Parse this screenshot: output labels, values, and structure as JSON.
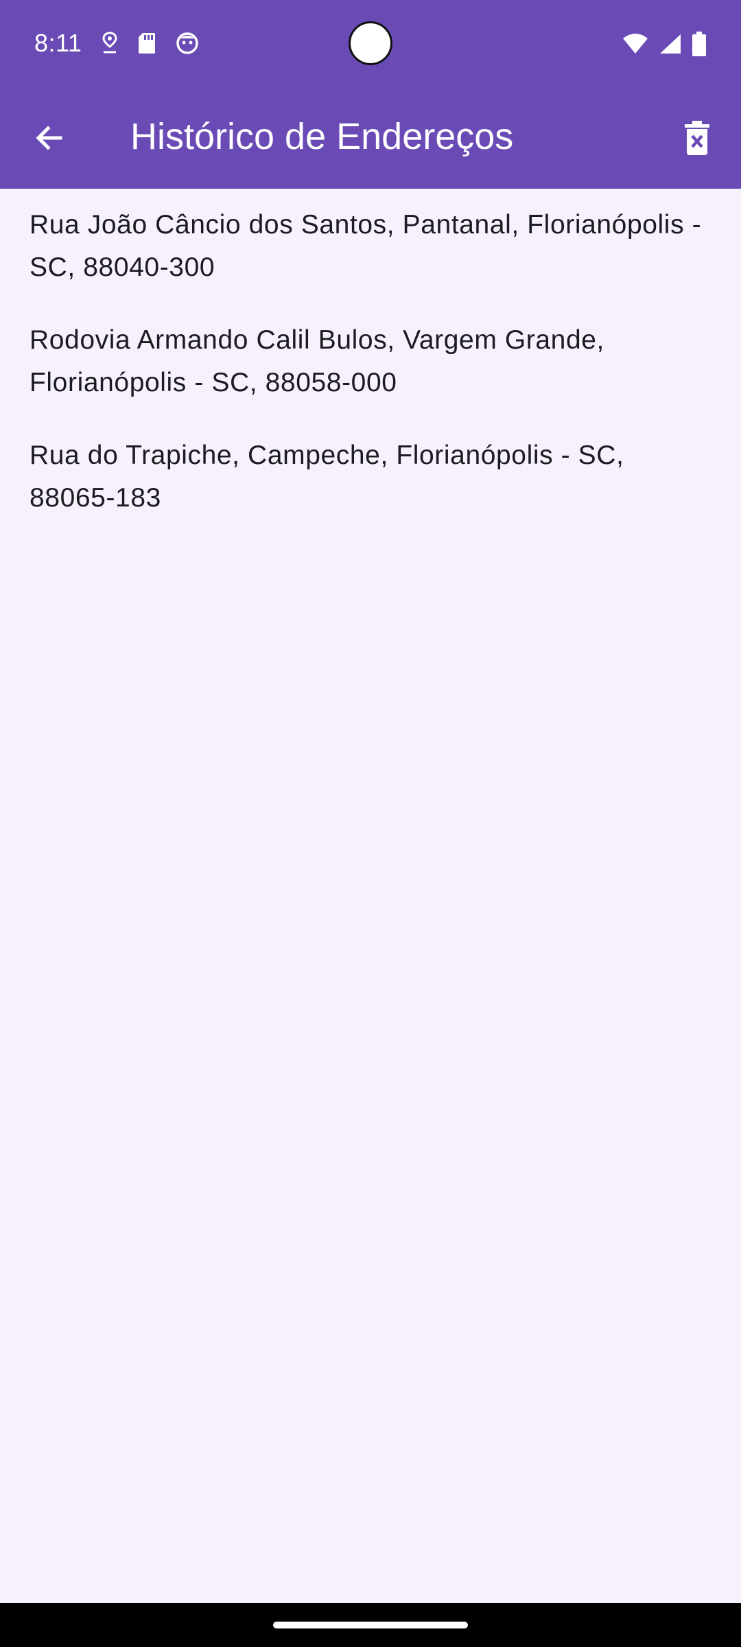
{
  "status_bar": {
    "time": "8:11",
    "left_icons": [
      "location-pin-icon",
      "sd-card-icon",
      "face-icon"
    ],
    "right_icons": [
      "wifi-icon",
      "cellular-signal-icon",
      "battery-icon"
    ]
  },
  "app_bar": {
    "title": "Histórico de Endereços",
    "back_icon": "arrow-back-icon",
    "action_icon": "delete-icon"
  },
  "addresses": [
    "Rua João Câncio dos Santos, Pantanal, Florianópolis - SC, 88040-300",
    "Rodovia Armando Calil Bulos, Vargem Grande, Florianópolis - SC, 88058-000",
    "Rua do Trapiche, Campeche, Florianópolis - SC, 88065-183"
  ],
  "colors": {
    "primary": "#6A4BB6",
    "background": "#F6F1FD",
    "text": "#1C1B1F"
  }
}
